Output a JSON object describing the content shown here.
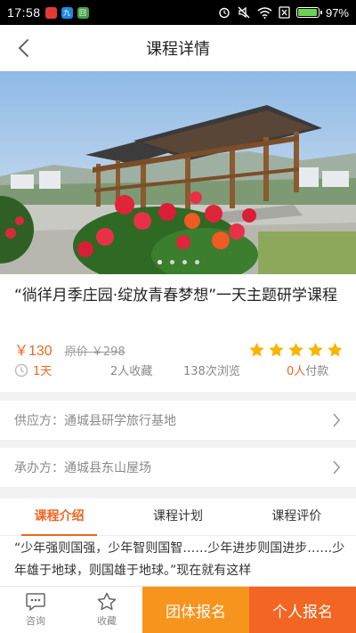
{
  "status_bar": {
    "time": "17:58",
    "battery": "97%",
    "battery_level": 0.97,
    "app_icon_labels": [
      "九",
      "回"
    ]
  },
  "header": {
    "title": "课程详情"
  },
  "banner": {
    "slide_count": 4,
    "active_slide": 1
  },
  "course": {
    "title": "“徜徉月季庄园·绽放青春梦想”一天主题研学课程",
    "price": "￥130",
    "original_price": "原价 ￥298",
    "rating_stars": 5,
    "duration": "1天",
    "favorites": "2人收藏",
    "views": "138次浏览",
    "paid_num": "0人",
    "paid_label": "付款"
  },
  "supplier": {
    "label": "供应方：通城县研学旅行基地"
  },
  "organizer": {
    "label": "承办方：通城县东山屋场"
  },
  "tabs": [
    {
      "label": "课程介绍",
      "active": true
    },
    {
      "label": "课程计划",
      "active": false
    },
    {
      "label": "课程评价",
      "active": false
    }
  ],
  "intro_text": "“少年强则国强，少年智则国智……少年进步则国进步……少年雄于地球，则国雄于地球。”现在就有这样",
  "bottom_bar": {
    "consult": "咨询",
    "favorite": "收藏",
    "group_signup": "团体报名",
    "personal_signup": "个人报名"
  },
  "colors": {
    "accent": "#f26522",
    "accent_light": "#f7941d",
    "star": "#f7b500"
  }
}
